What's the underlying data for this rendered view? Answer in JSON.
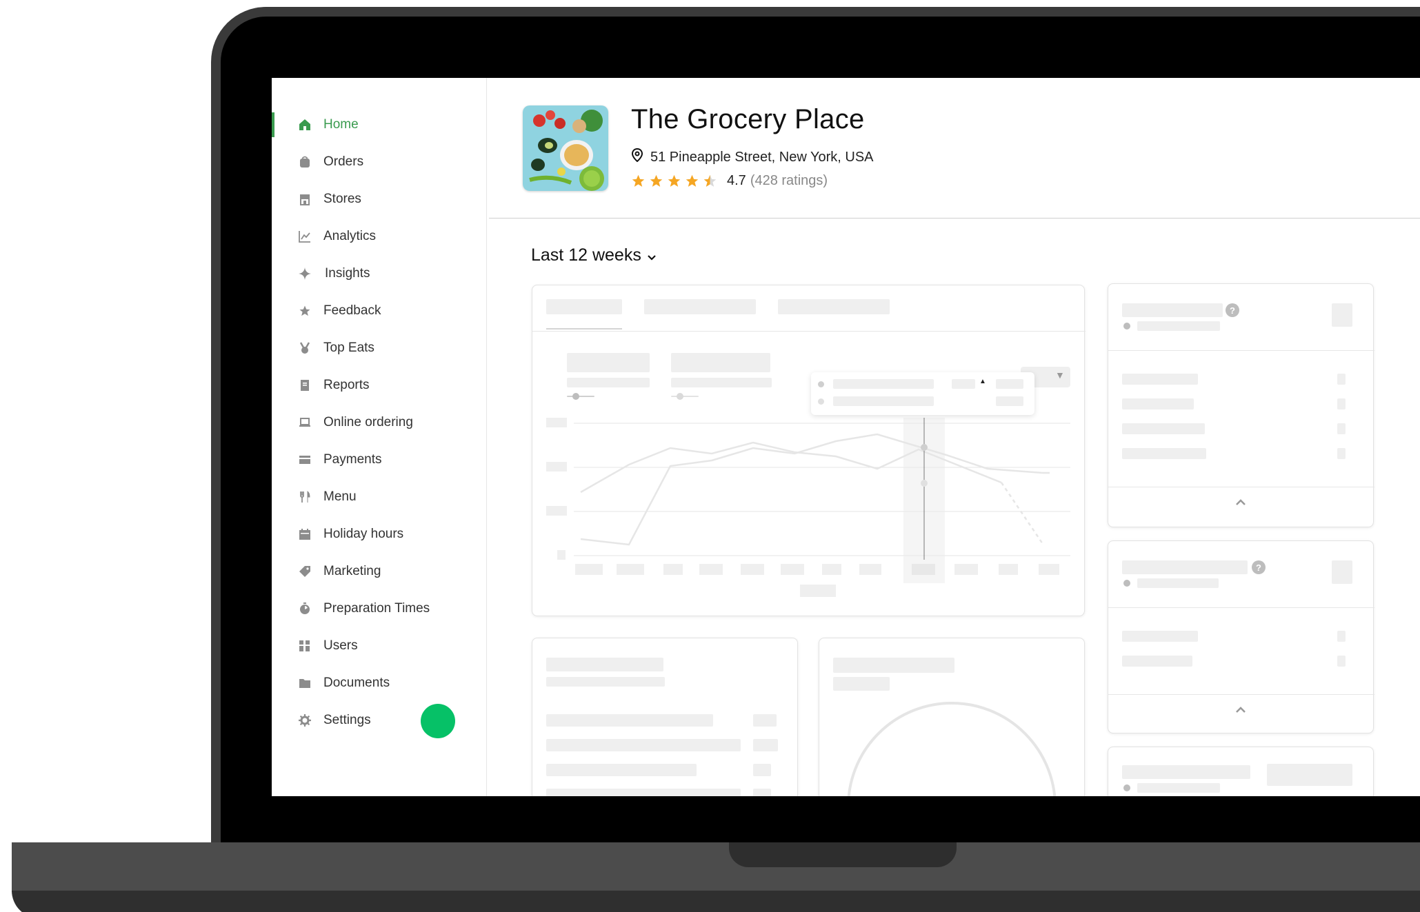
{
  "sidebar": {
    "items": [
      {
        "label": "Home",
        "icon": "home-icon",
        "active": true
      },
      {
        "label": "Orders",
        "icon": "bag-icon"
      },
      {
        "label": "Stores",
        "icon": "store-icon"
      },
      {
        "label": "Analytics",
        "icon": "chart-icon"
      },
      {
        "label": "Insights",
        "icon": "sparkle-icon"
      },
      {
        "label": "Feedback",
        "icon": "star-icon"
      },
      {
        "label": "Top Eats",
        "icon": "medal-icon"
      },
      {
        "label": "Reports",
        "icon": "document-icon"
      },
      {
        "label": "Online ordering",
        "icon": "laptop-icon"
      },
      {
        "label": "Payments",
        "icon": "card-icon"
      },
      {
        "label": "Menu",
        "icon": "utensils-icon"
      },
      {
        "label": "Holiday hours",
        "icon": "calendar-icon"
      },
      {
        "label": "Marketing",
        "icon": "tag-icon"
      },
      {
        "label": "Preparation Times",
        "icon": "timer-icon"
      },
      {
        "label": "Users",
        "icon": "users-icon"
      },
      {
        "label": "Documents",
        "icon": "folder-icon"
      },
      {
        "label": "Settings",
        "icon": "gear-icon"
      }
    ]
  },
  "store": {
    "name": "The Grocery Place",
    "address": "51 Pineapple Street, New York, USA",
    "rating": "4.7",
    "rating_count": "(428 ratings)",
    "stars_filled": 4.5
  },
  "filter": {
    "period_label": "Last 12 weeks"
  },
  "colors": {
    "accent": "#3a9b4f",
    "star": "#f5a623",
    "fab": "#06c167"
  }
}
